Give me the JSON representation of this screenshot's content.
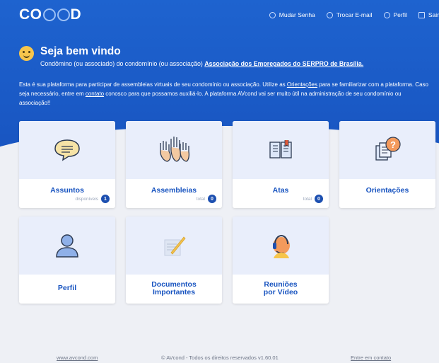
{
  "brand": {
    "logo_left": "CO",
    "logo_right": "D"
  },
  "nav": {
    "change_password": "Mudar Senha",
    "change_email": "Trocar E-mail",
    "profile": "Perfil",
    "logout": "Sair"
  },
  "welcome": {
    "title": "Seja bem vindo",
    "subtitle_prefix": "Condômino (ou associado) do condomínio (ou associação)",
    "association": "Associação dos Empregados do SERPRO de Brasília."
  },
  "intro": {
    "part1": "Esta é sua plataforma para participar de assembleias virtuais de seu condomínio ou associação. Utilize as ",
    "link1": "Orientações",
    "part2": " para se familiarizar com a plataforma. Caso seja necessário, entre em ",
    "link2": "contato",
    "part3": " conosco para que possamos auxiliá-lo. A plataforma AVcond vai ser muito útil na administração de seu condomínio ou associação!!"
  },
  "cards": [
    {
      "label": "Assuntos",
      "meta": "disponíveis",
      "count": "1",
      "icon": "speech-bubble-icon"
    },
    {
      "label": "Assembleias",
      "meta": "total",
      "count": "0",
      "icon": "raised-hands-icon"
    },
    {
      "label": "Atas",
      "meta": "total",
      "count": "0",
      "icon": "open-book-icon"
    },
    {
      "label": "Orientações",
      "icon": "question-document-icon"
    },
    {
      "label": "Perfil",
      "icon": "user-icon"
    },
    {
      "label_line1": "Documentos",
      "label_line2": "Importantes",
      "icon": "document-pen-icon"
    },
    {
      "label_line1": "Reuniões",
      "label_line2": "por Vídeo",
      "icon": "headset-user-icon"
    }
  ],
  "footer": {
    "site": "www.avcond.com",
    "copyright": "© AVcond - Todos os direitos reservados v1.60.01",
    "contact": "Entre em contato"
  },
  "colors": {
    "primary": "#1854c0",
    "card_top": "#e9eefb",
    "badge": "#1c4fb0"
  }
}
